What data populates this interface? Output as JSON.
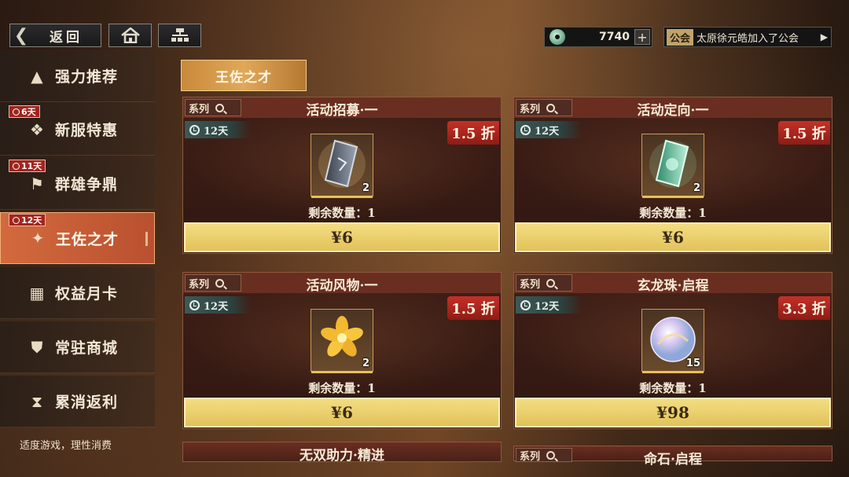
{
  "topbar": {
    "back_label": "返回",
    "home_icon": "home-icon",
    "menu_icon": "hierarchy-icon",
    "currency_amount": "7740",
    "currency_plus": "+",
    "guild_tag": "公会",
    "guild_message": "太原徐元皓加入了公会",
    "guild_arrow": "▶"
  },
  "sidebar": {
    "items": [
      {
        "label": "强力推荐",
        "icon": "▲",
        "timer": ""
      },
      {
        "label": "新服特惠",
        "icon": "❖",
        "timer": "6天"
      },
      {
        "label": "群雄争鼎",
        "icon": "⚑",
        "timer": "11天"
      },
      {
        "label": "王佐之才",
        "icon": "✦",
        "timer": "12天"
      },
      {
        "label": "权益月卡",
        "icon": "▦",
        "timer": ""
      },
      {
        "label": "常驻商城",
        "icon": "⛊",
        "timer": ""
      },
      {
        "label": "累消返利",
        "icon": "⧗",
        "timer": ""
      }
    ],
    "notice": "适度游戏，理性消费"
  },
  "main": {
    "tab_label": "王佐之才",
    "cards": [
      {
        "series": "系列",
        "title": "活动招募·一",
        "days": "12天",
        "discount": "1.5 折",
        "count": "2",
        "remain": "剩余数量：1",
        "price": "¥6",
        "item_icon": "recruit-token-icon"
      },
      {
        "series": "系列",
        "title": "活动定向·一",
        "days": "12天",
        "discount": "1.5 折",
        "count": "2",
        "remain": "剩余数量：1",
        "price": "¥6",
        "item_icon": "directed-token-icon"
      },
      {
        "series": "系列",
        "title": "活动风物·一",
        "days": "12天",
        "discount": "1.5 折",
        "count": "2",
        "remain": "剩余数量：1",
        "price": "¥6",
        "item_icon": "golden-flower-icon"
      },
      {
        "series": "系列",
        "title": "玄龙珠·启程",
        "days": "12天",
        "discount": "3.3 折",
        "count": "15",
        "remain": "剩余数量：1",
        "price": "¥98",
        "item_icon": "dragon-pearl-icon"
      },
      {
        "series": "",
        "title": "无双助力·精进"
      },
      {
        "series": "系列",
        "title": "命石·启程"
      }
    ]
  },
  "colors": {
    "accent_tab": "#d36a3e",
    "price_gold": "#e2c25a",
    "discount_red": "#c43127",
    "timer_teal": "#3d5956"
  }
}
